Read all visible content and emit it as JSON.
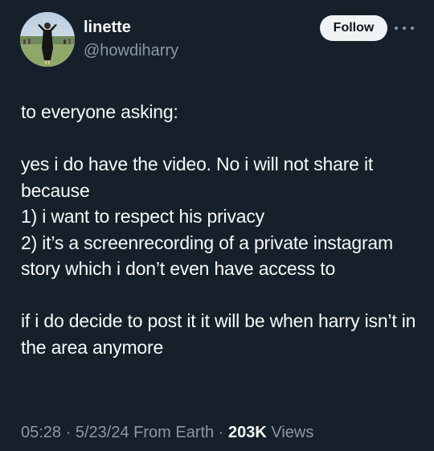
{
  "user": {
    "display_name": "linette",
    "handle": "@howdiharry"
  },
  "actions": {
    "follow_label": "Follow",
    "more_icon": "more-horizontal-icon"
  },
  "tweet": {
    "paragraphs": [
      "to everyone asking:",
      "yes i do have the video. No i will not share it because\n1) i want to respect his privacy\n2) it’s a screenrecording of a private instagram story which i don’t even have access to",
      "if i do decide to post it it will be when harry isn’t in the area anymore"
    ]
  },
  "meta": {
    "time": "05:28",
    "date": "5/23/24",
    "source": "From Earth",
    "views_count": "203K",
    "views_label": "Views",
    "separator": "·"
  },
  "colors": {
    "background": "#15202b",
    "text": "#f7f9f9",
    "secondary": "#8b98a5",
    "follow_bg": "#eff3f4"
  }
}
